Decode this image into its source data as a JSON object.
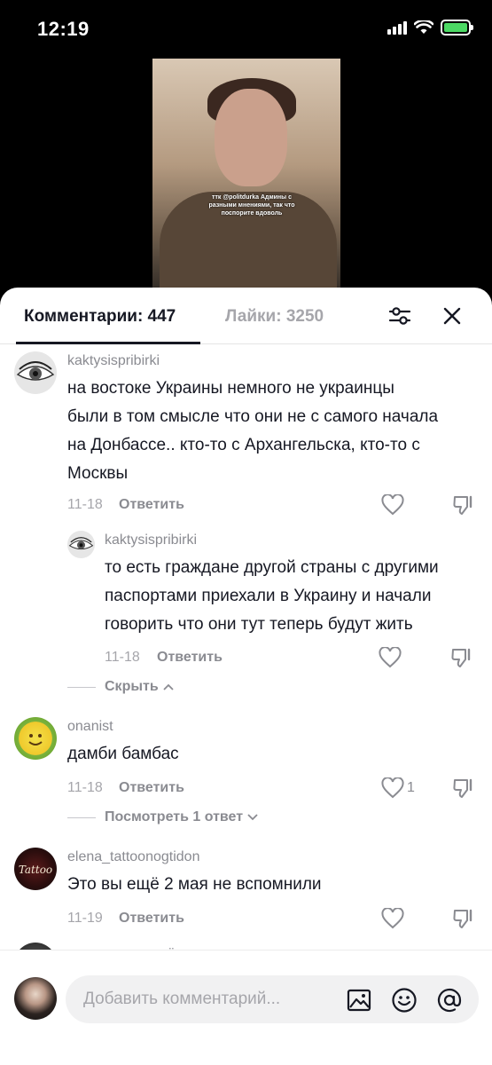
{
  "status": {
    "time": "12:19"
  },
  "video": {
    "caption": "ттк @politdurka Админы с разными мнениями, так что поспорите вдоволь"
  },
  "tabs": {
    "comments": "Комментарии: 447",
    "likes": "Лайки: 3250"
  },
  "comments": [
    {
      "username": "kaktysispribirki",
      "lines": [
        "на востоке Украины немного не украинцы",
        "были в том смысле что они не с самого начала",
        "на Донбассе.. кто-то с Архангельска, кто-то с",
        "Москвы"
      ],
      "date": "11-18",
      "reply": "Ответить",
      "likes": ""
    },
    {
      "username": "kaktysispribirki",
      "lines": [
        "то есть граждане другой страны с другими",
        "паспортами приехали в Украину и начали",
        "говорить что они тут теперь будут жить"
      ],
      "date": "11-18",
      "reply": "Ответить",
      "likes": ""
    },
    {
      "username": "onanist",
      "lines": [
        "дамби бамбас"
      ],
      "date": "11-18",
      "reply": "Ответить",
      "likes": "1"
    },
    {
      "username": "elena_tattoonogtidon",
      "lines": [
        "Это вы ещё 2 мая не вспомнили"
      ],
      "date": "11-19",
      "reply": "Ответить",
      "likes": ""
    },
    {
      "username": "щитпостмашинёнок",
      "lines": [],
      "date": "",
      "reply": "",
      "likes": ""
    }
  ],
  "threads": {
    "hide": "Скрыть",
    "view_reply": "Посмотреть 1 ответ"
  },
  "avatars": {
    "elena": "Tattoo"
  },
  "composer": {
    "placeholder": "Добавить комментарий..."
  },
  "colors": {
    "primary_text": "#161823",
    "secondary_text": "#8a8b91",
    "battery": "#4cd964"
  },
  "icons": [
    "signal-icon",
    "wifi-icon",
    "battery-icon",
    "filter-icon",
    "close-icon",
    "heart-icon",
    "dislike-icon",
    "image-icon",
    "emoji-icon",
    "mention-icon"
  ]
}
